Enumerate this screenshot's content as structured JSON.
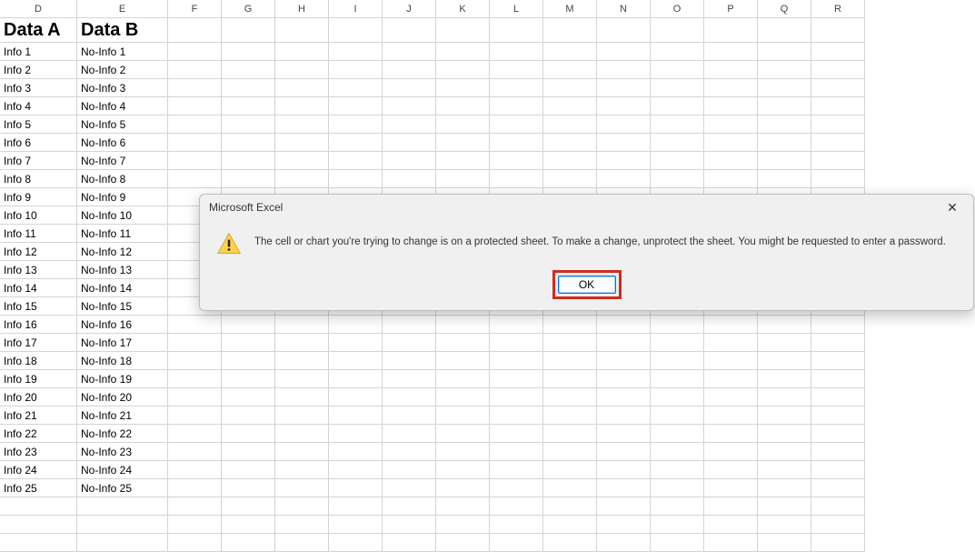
{
  "column_letters": [
    "D",
    "E",
    "F",
    "G",
    "H",
    "I",
    "J",
    "K",
    "L",
    "M",
    "N",
    "O",
    "P",
    "Q",
    "R"
  ],
  "headers": {
    "colD": "Data A",
    "colE": "Data B"
  },
  "rows": [
    {
      "d": "Info 1",
      "e": "No-Info 1"
    },
    {
      "d": "Info 2",
      "e": "No-Info 2"
    },
    {
      "d": "Info 3",
      "e": "No-Info 3"
    },
    {
      "d": "Info 4",
      "e": "No-Info 4"
    },
    {
      "d": "Info 5",
      "e": "No-Info 5"
    },
    {
      "d": "Info 6",
      "e": "No-Info 6"
    },
    {
      "d": "Info 7",
      "e": "No-Info 7"
    },
    {
      "d": "Info 8",
      "e": "No-Info 8"
    },
    {
      "d": "Info 9",
      "e": "No-Info 9"
    },
    {
      "d": "Info 10",
      "e": "No-Info 10"
    },
    {
      "d": "Info 11",
      "e": "No-Info 11"
    },
    {
      "d": "Info 12",
      "e": "No-Info 12"
    },
    {
      "d": "Info 13",
      "e": "No-Info 13"
    },
    {
      "d": "Info 14",
      "e": "No-Info 14"
    },
    {
      "d": "Info 15",
      "e": "No-Info 15"
    },
    {
      "d": "Info 16",
      "e": "No-Info 16"
    },
    {
      "d": "Info 17",
      "e": "No-Info 17"
    },
    {
      "d": "Info 18",
      "e": "No-Info 18"
    },
    {
      "d": "Info 19",
      "e": "No-Info 19"
    },
    {
      "d": "Info 20",
      "e": "No-Info 20"
    },
    {
      "d": "Info 21",
      "e": "No-Info 21"
    },
    {
      "d": "Info 22",
      "e": "No-Info 22"
    },
    {
      "d": "Info 23",
      "e": "No-Info 23"
    },
    {
      "d": "Info 24",
      "e": "No-Info 24"
    },
    {
      "d": "Info 25",
      "e": "No-Info 25"
    }
  ],
  "dialog": {
    "title": "Microsoft Excel",
    "message": "The cell or chart you're trying to change is on a protected sheet. To make a change, unprotect the sheet. You might be requested to enter a password.",
    "ok_label": "OK",
    "close_glyph": "✕"
  }
}
